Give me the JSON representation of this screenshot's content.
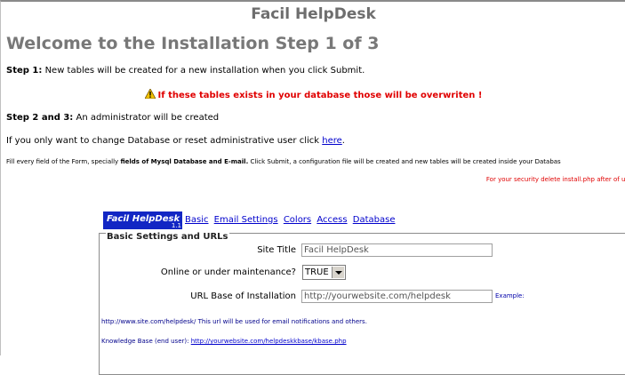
{
  "app_title": "Facil HelpDesk",
  "heading": "Welcome to the Installation Step 1 of 3",
  "step1": {
    "label": "Step 1:",
    "text": "New tables will be created for a new installation when you click Submit."
  },
  "warning": "If these tables exists in your database those will be overwriten !",
  "step23": {
    "label": "Step 2 and 3:",
    "text": "An administrator will be created"
  },
  "change_db": {
    "text": "If you only want to change Database or reset administrative user click",
    "link": "here",
    "suffix": "."
  },
  "instructions": {
    "pre": "Fill every field of the Form, specially",
    "bold": "fields of Mysql Database and E-mail.",
    "post": "Click Submit, a configuration file will be created and new tables will be created inside your Databas"
  },
  "security_note": "For your security delete install.php after of usi",
  "logo": {
    "title": "Facil HelpDesk",
    "version": "1.1"
  },
  "tabs": [
    "Basic",
    "Email Settings",
    "Colors",
    "Access",
    "Database"
  ],
  "section_title": "Basic Settings and URLs",
  "fields": {
    "site_title": {
      "label": "Site Title",
      "value": "Facil HelpDesk"
    },
    "online": {
      "label": "Online or under maintenance?",
      "value": "TRUE"
    },
    "url_base": {
      "label": "URL Base of Installation",
      "value": "http://yourwebsite.com/helpdesk",
      "example": "Example:"
    }
  },
  "url_note": {
    "url": "http://www.site.com/helpdesk/",
    "text": "This url will be used for email notifications and others."
  },
  "kb_note": {
    "label": "Knowledge Base (end user):",
    "link": "http://yourwebsite.com/helpdeskkbase/kbase.php"
  }
}
